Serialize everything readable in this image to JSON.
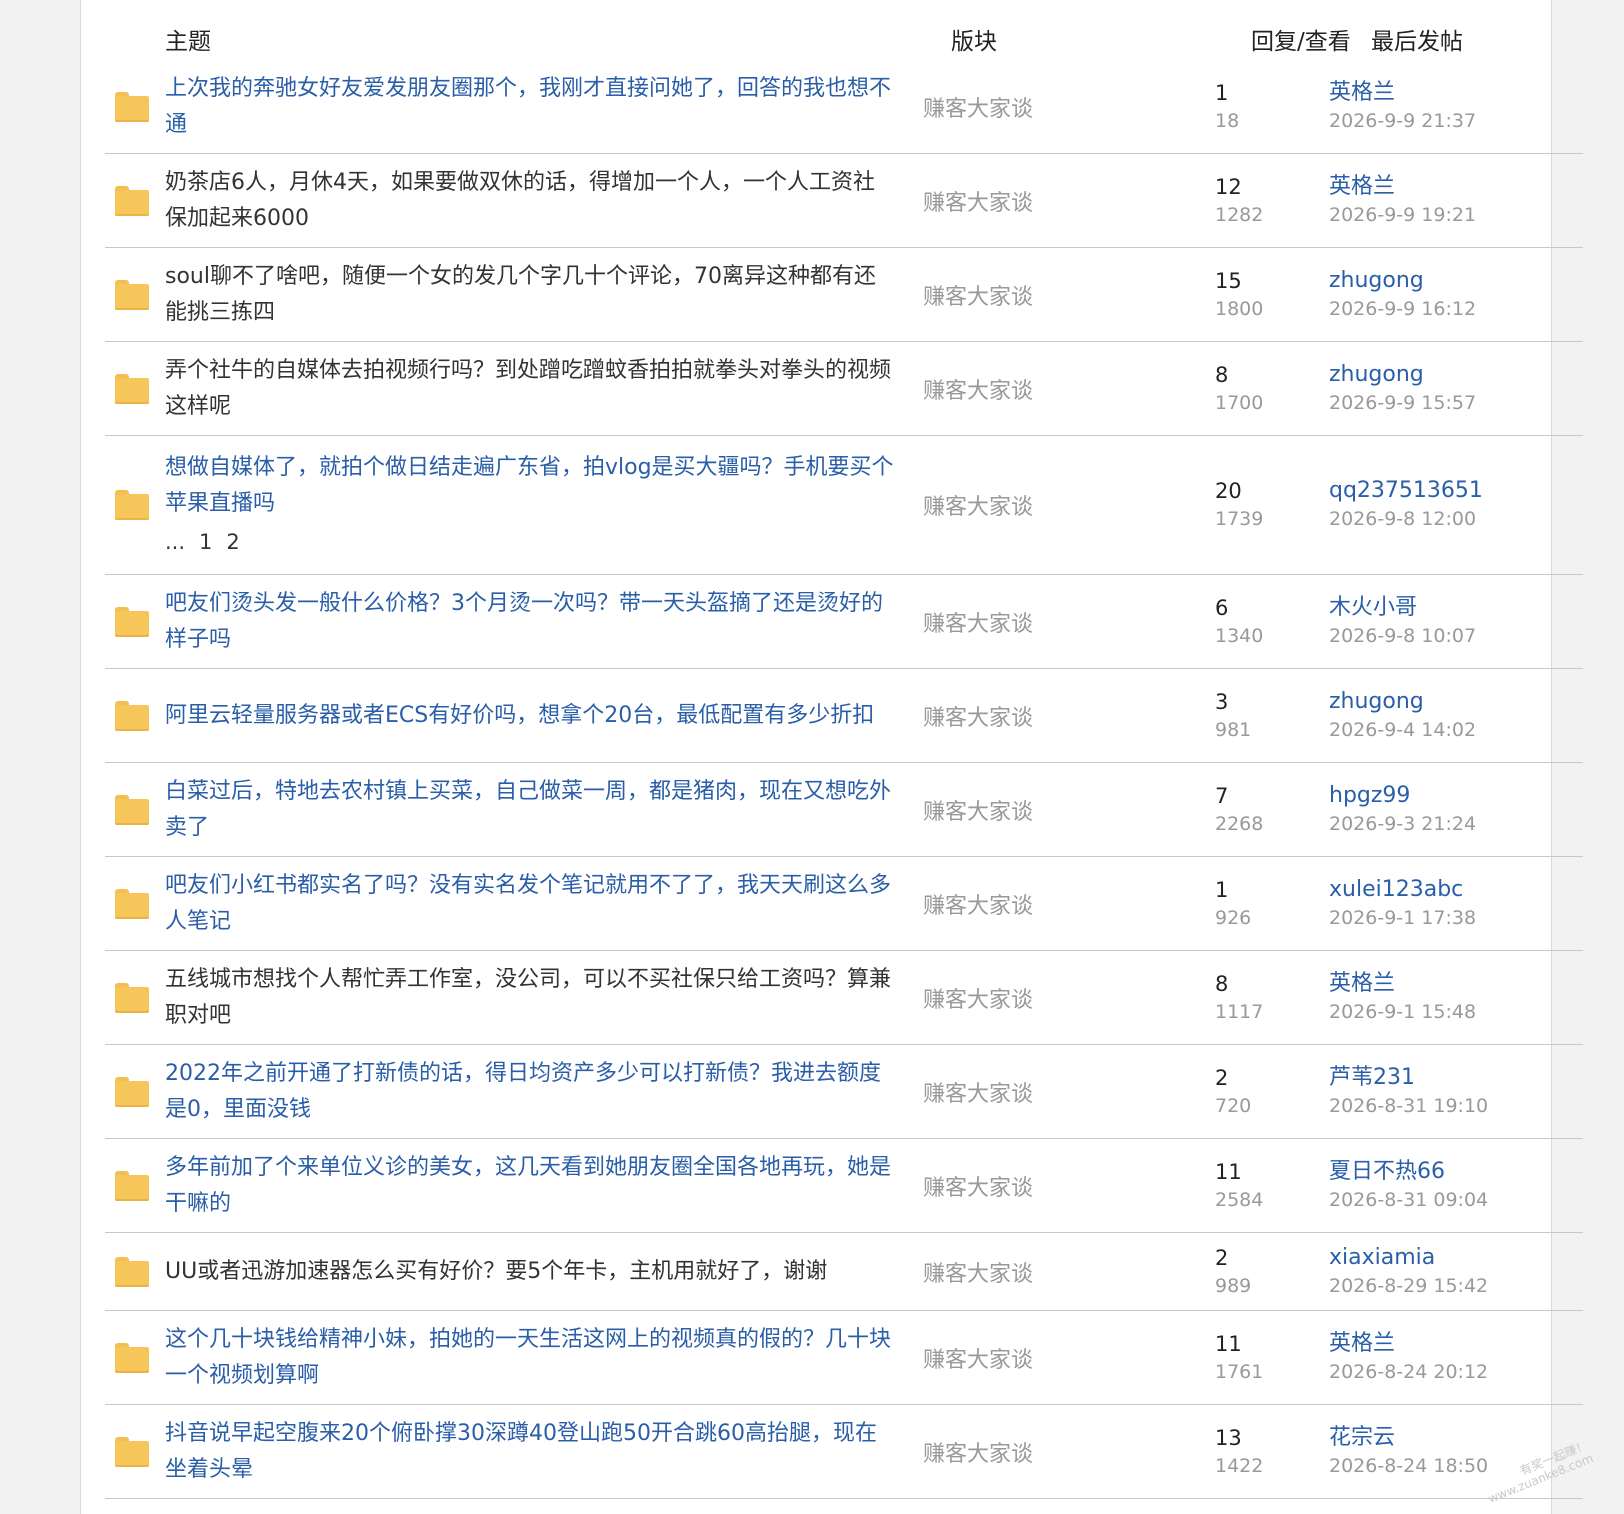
{
  "header": {
    "topic": "主题",
    "forum": "版块",
    "reply_view": "回复/查看",
    "last_post": "最后发帖"
  },
  "threads": [
    {
      "title": "上次我的奔驰女好友爱发朋友圈那个，我刚才直接问她了，回答的我也想不通",
      "link": true,
      "forum": "赚客大家谈",
      "replies": "1",
      "views": "18",
      "user": "英格兰",
      "time": "2026-9-9 21:37"
    },
    {
      "title": "奶茶店6人，月休4天，如果要做双休的话，得增加一个人，一个人工资社保加起来6000",
      "link": false,
      "forum": "赚客大家谈",
      "replies": "12",
      "views": "1282",
      "user": "英格兰",
      "time": "2026-9-9 19:21"
    },
    {
      "title": "soul聊不了啥吧，随便一个女的发几个字几十个评论，70离异这种都有还能挑三拣四",
      "link": false,
      "forum": "赚客大家谈",
      "replies": "15",
      "views": "1800",
      "user": "zhugong",
      "time": "2026-9-9 16:12"
    },
    {
      "title": "弄个社牛的自媒体去拍视频行吗？到处蹭吃蹭蚊香拍拍就拳头对拳头的视频这样呢",
      "link": false,
      "forum": "赚客大家谈",
      "replies": "8",
      "views": "1700",
      "user": "zhugong",
      "time": "2026-9-9 15:57"
    },
    {
      "title": "想做自媒体了，就拍个做日结走遍广东省，拍vlog是买大疆吗？手机要买个苹果直播吗",
      "link": true,
      "forum": "赚客大家谈",
      "replies": "20",
      "views": "1739",
      "user": "qq237513651",
      "time": "2026-9-8 12:00",
      "pager": [
        "...",
        "1",
        "2"
      ]
    },
    {
      "title": "吧友们烫头发一般什么价格？3个月烫一次吗？带一天头盔摘了还是烫好的样子吗",
      "link": true,
      "forum": "赚客大家谈",
      "replies": "6",
      "views": "1340",
      "user": "木火小哥",
      "time": "2026-9-8 10:07"
    },
    {
      "title": "阿里云轻量服务器或者ECS有好价吗，想拿个20台，最低配置有多少折扣",
      "link": true,
      "forum": "赚客大家谈",
      "replies": "3",
      "views": "981",
      "user": "zhugong",
      "time": "2026-9-4 14:02"
    },
    {
      "title": "白菜过后，特地去农村镇上买菜，自己做菜一周，都是猪肉，现在又想吃外卖了",
      "link": true,
      "forum": "赚客大家谈",
      "replies": "7",
      "views": "2268",
      "user": "hpgz99",
      "time": "2026-9-3 21:24"
    },
    {
      "title": "吧友们小红书都实名了吗？没有实名发个笔记就用不了了，我天天刷这么多人笔记",
      "link": true,
      "forum": "赚客大家谈",
      "replies": "1",
      "views": "926",
      "user": "xulei123abc",
      "time": "2026-9-1 17:38"
    },
    {
      "title": "五线城市想找个人帮忙弄工作室，没公司，可以不买社保只给工资吗？算兼职对吧",
      "link": false,
      "forum": "赚客大家谈",
      "replies": "8",
      "views": "1117",
      "user": "英格兰",
      "time": "2026-9-1 15:48"
    },
    {
      "title": "2022年之前开通了打新债的话，得日均资产多少可以打新债？我进去额度是0，里面没钱",
      "link": true,
      "forum": "赚客大家谈",
      "replies": "2",
      "views": "720",
      "user": "芦苇231",
      "time": "2026-8-31 19:10"
    },
    {
      "title": "多年前加了个来单位义诊的美女，这几天看到她朋友圈全国各地再玩，她是干嘛的",
      "link": true,
      "forum": "赚客大家谈",
      "replies": "11",
      "views": "2584",
      "user": "夏日不热66",
      "time": "2026-8-31 09:04"
    },
    {
      "title": "UU或者迅游加速器怎么买有好价？要5个年卡，主机用就好了，谢谢",
      "link": false,
      "forum": "赚客大家谈",
      "replies": "2",
      "views": "989",
      "user": "xiaxiamia",
      "time": "2026-8-29 15:42"
    },
    {
      "title": "这个几十块钱给精神小妹，拍她的一天生活这网上的视频真的假的？几十块一个视频划算啊",
      "link": true,
      "forum": "赚客大家谈",
      "replies": "11",
      "views": "1761",
      "user": "英格兰",
      "time": "2026-8-24 20:12"
    },
    {
      "title": "抖音说早起空腹来20个俯卧撑30深蹲40登山跑50开合跳60高抬腿，现在坐着头晕",
      "link": true,
      "forum": "赚客大家谈",
      "replies": "13",
      "views": "1422",
      "user": "花宗云",
      "time": "2026-8-24 18:50"
    }
  ],
  "watermark": {
    "line1": "有奖一起赚！",
    "line2": "www.zuanke8.com"
  }
}
